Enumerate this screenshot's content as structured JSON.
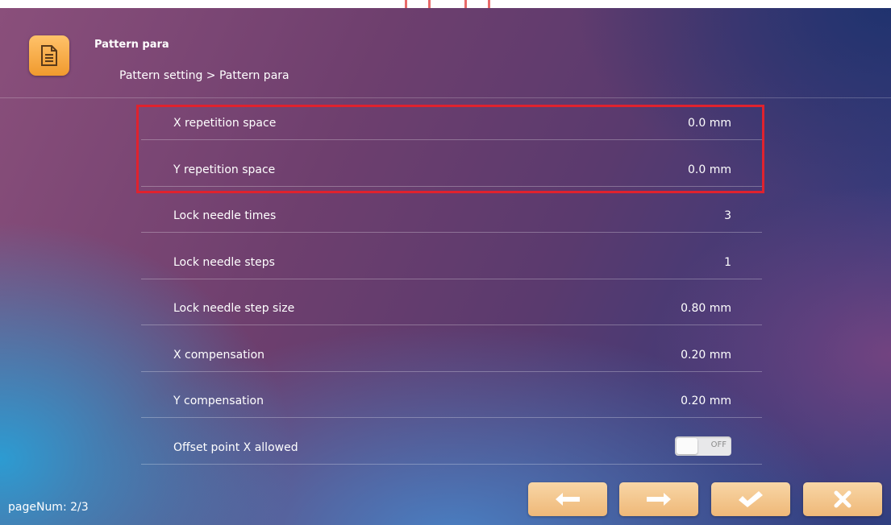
{
  "header": {
    "title": "Pattern para",
    "breadcrumb": "Pattern setting > Pattern para"
  },
  "rows": [
    {
      "label": "X repetition space",
      "value": "0.0 mm"
    },
    {
      "label": "Y repetition space",
      "value": "0.0 mm"
    },
    {
      "label": "Lock needle times",
      "value": "3"
    },
    {
      "label": "Lock needle steps",
      "value": "1"
    },
    {
      "label": "Lock needle step size",
      "value": "0.80 mm"
    },
    {
      "label": "X compensation",
      "value": "0.20 mm"
    },
    {
      "label": "Y compensation",
      "value": "0.20 mm"
    },
    {
      "label": "Offset point X allowed",
      "toggle": "OFF"
    }
  ],
  "footer": {
    "page_num": "pageNum: 2/3",
    "buttons": [
      "prev-arrow-icon",
      "next-arrow-icon",
      "confirm-check-icon",
      "close-x-icon"
    ]
  },
  "colors": {
    "highlight": "#e0222e",
    "button": "#efb878",
    "icon_accent": "#f09a2e"
  }
}
